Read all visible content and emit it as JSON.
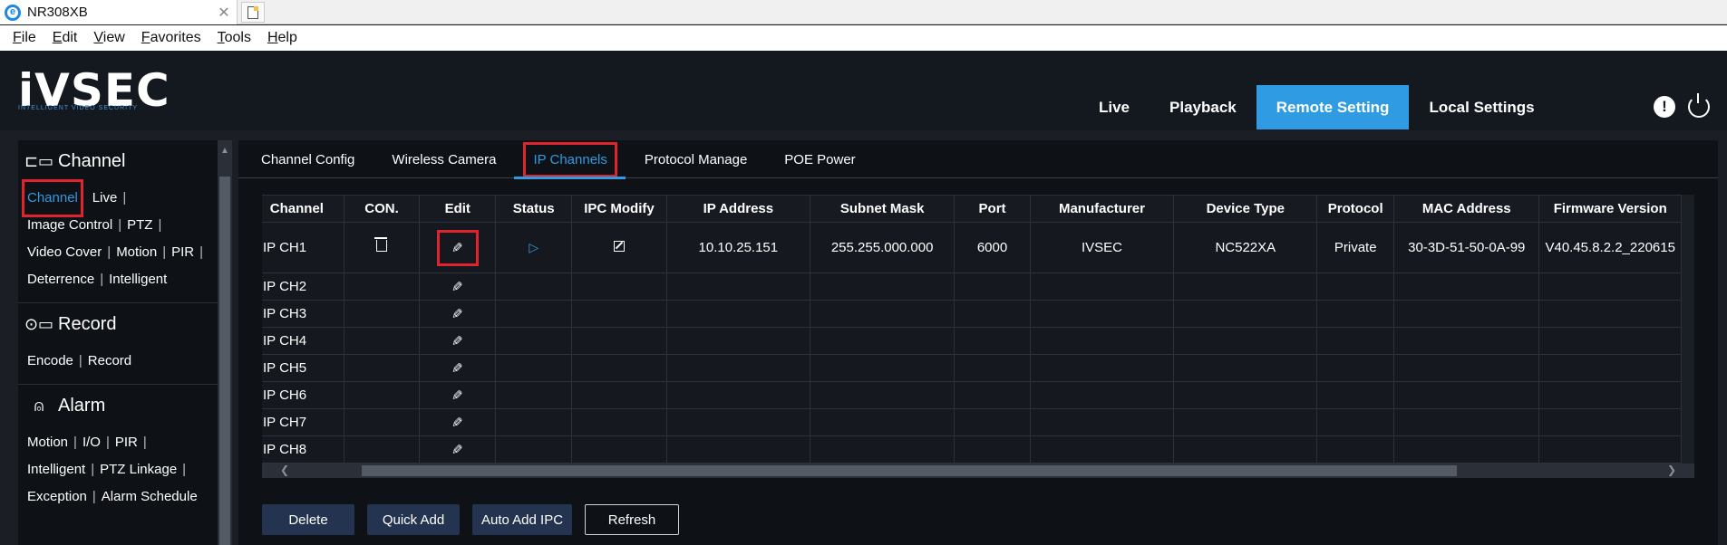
{
  "browser": {
    "tab_title": "NR308XB",
    "menu": [
      "File",
      "Edit",
      "View",
      "Favorites",
      "Tools",
      "Help"
    ],
    "menu_accel": [
      "F",
      "E",
      "V",
      "F",
      "T",
      "H"
    ]
  },
  "header": {
    "logo": "iVSEC",
    "logo_sub": "INTELLIGENT VIDEO SECURITY",
    "nav": [
      "Live",
      "Playback",
      "Remote Setting",
      "Local Settings"
    ],
    "active_nav": "Remote Setting",
    "accent": "#2e9be2"
  },
  "sidebar": {
    "channel": {
      "title": "Channel",
      "icon": "camera-icon",
      "links": [
        "Channel",
        "Live",
        "Image Control",
        "PTZ",
        "Video Cover",
        "Motion",
        "PIR",
        "Deterrence",
        "Intelligent"
      ],
      "active": "Channel"
    },
    "record": {
      "title": "Record",
      "icon": "video-camera-icon",
      "links": [
        "Encode",
        "Record"
      ]
    },
    "alarm": {
      "title": "Alarm",
      "icon": "alarm-icon",
      "links": [
        "Motion",
        "I/O",
        "PIR",
        "Intelligent",
        "PTZ Linkage",
        "Exception",
        "Alarm Schedule"
      ]
    }
  },
  "subtabs": [
    "Channel Config",
    "Wireless Camera",
    "IP Channels",
    "Protocol Manage",
    "POE Power"
  ],
  "active_subtab": "IP Channels",
  "table": {
    "headers": [
      "Channel",
      "CON.",
      "Edit",
      "Status",
      "IPC Modify",
      "IP Address",
      "Subnet Mask",
      "Port",
      "Manufacturer",
      "Device Type",
      "Protocol",
      "MAC Address",
      "Firmware Version"
    ],
    "first_row": {
      "channel": "IP CH1",
      "ip": "10.10.25.151",
      "mask": "255.255.000.000",
      "port": "6000",
      "manufacturer": "IVSEC",
      "device_type": "NC522XA",
      "protocol": "Private",
      "mac": "30-3D-51-50-0A-99",
      "firmware": "V40.45.8.2.2_220615"
    },
    "empty_rows": [
      "IP CH2",
      "IP CH3",
      "IP CH4",
      "IP CH5",
      "IP CH6",
      "IP CH7",
      "IP CH8"
    ]
  },
  "buttons": {
    "delete": "Delete",
    "quick_add": "Quick Add",
    "auto_add": "Auto Add IPC",
    "refresh": "Refresh"
  }
}
